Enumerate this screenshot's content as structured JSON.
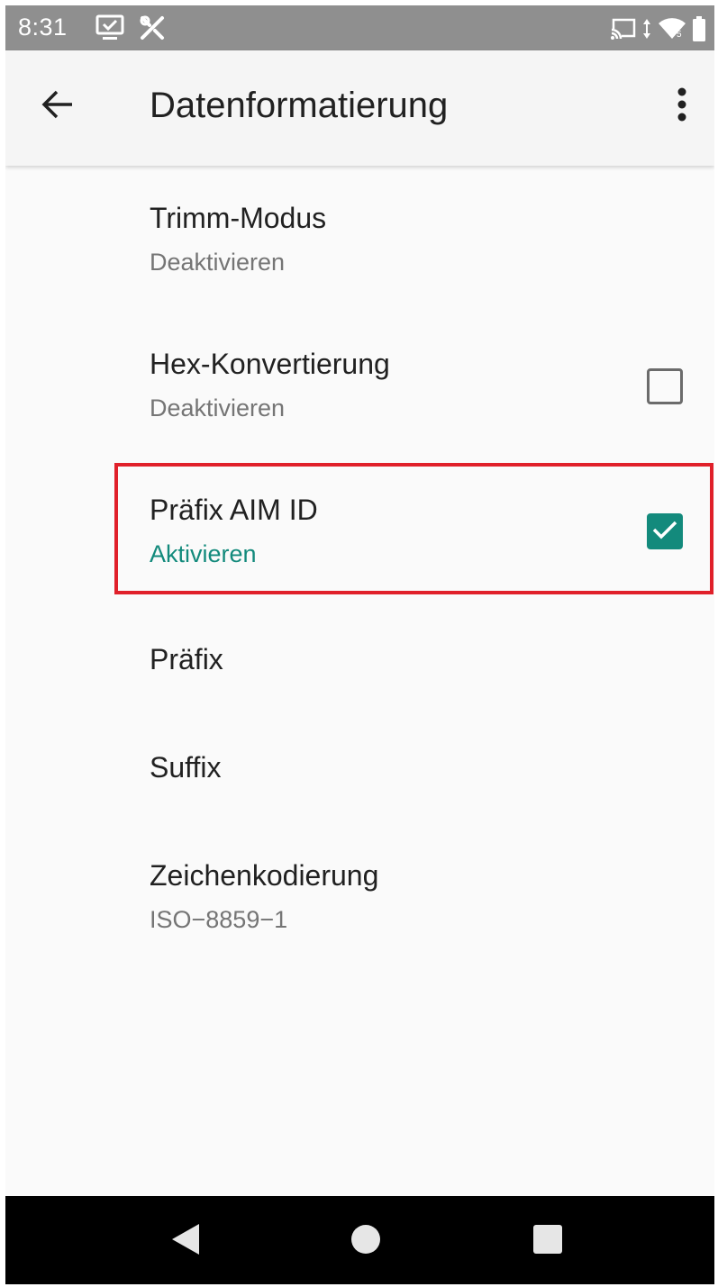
{
  "status_bar": {
    "time": "8:31",
    "left_icons": [
      "screenshot-icon",
      "tools-icon"
    ],
    "right_icons": [
      "cast-icon",
      "data-arrows-icon",
      "wifi-icon",
      "battery-icon"
    ],
    "background_color": "#8f8f8f"
  },
  "app_bar": {
    "title": "Datenformatierung",
    "back_icon": "arrow-back-icon",
    "menu_icon": "more-vert-icon"
  },
  "settings": [
    {
      "title": "Trimm-Modus",
      "summary": "Deaktivieren",
      "has_checkbox": false
    },
    {
      "title": "Hex-Konvertierung",
      "summary": "Deaktivieren",
      "has_checkbox": true,
      "checked": false
    },
    {
      "title": "Präfix AIM ID",
      "summary": "Aktivieren",
      "has_checkbox": true,
      "checked": true,
      "highlighted": true
    },
    {
      "title": "Präfix",
      "has_checkbox": false
    },
    {
      "title": "Suffix",
      "has_checkbox": false
    },
    {
      "title": "Zeichenkodierung",
      "summary": "ISO−8859−1",
      "has_checkbox": false
    }
  ],
  "colors": {
    "accent": "#138a7c",
    "highlight_border": "#e0202a",
    "background": "#fafafa"
  },
  "nav_bar": {
    "buttons": [
      "back-triangle-icon",
      "home-circle-icon",
      "recents-square-icon"
    ]
  }
}
